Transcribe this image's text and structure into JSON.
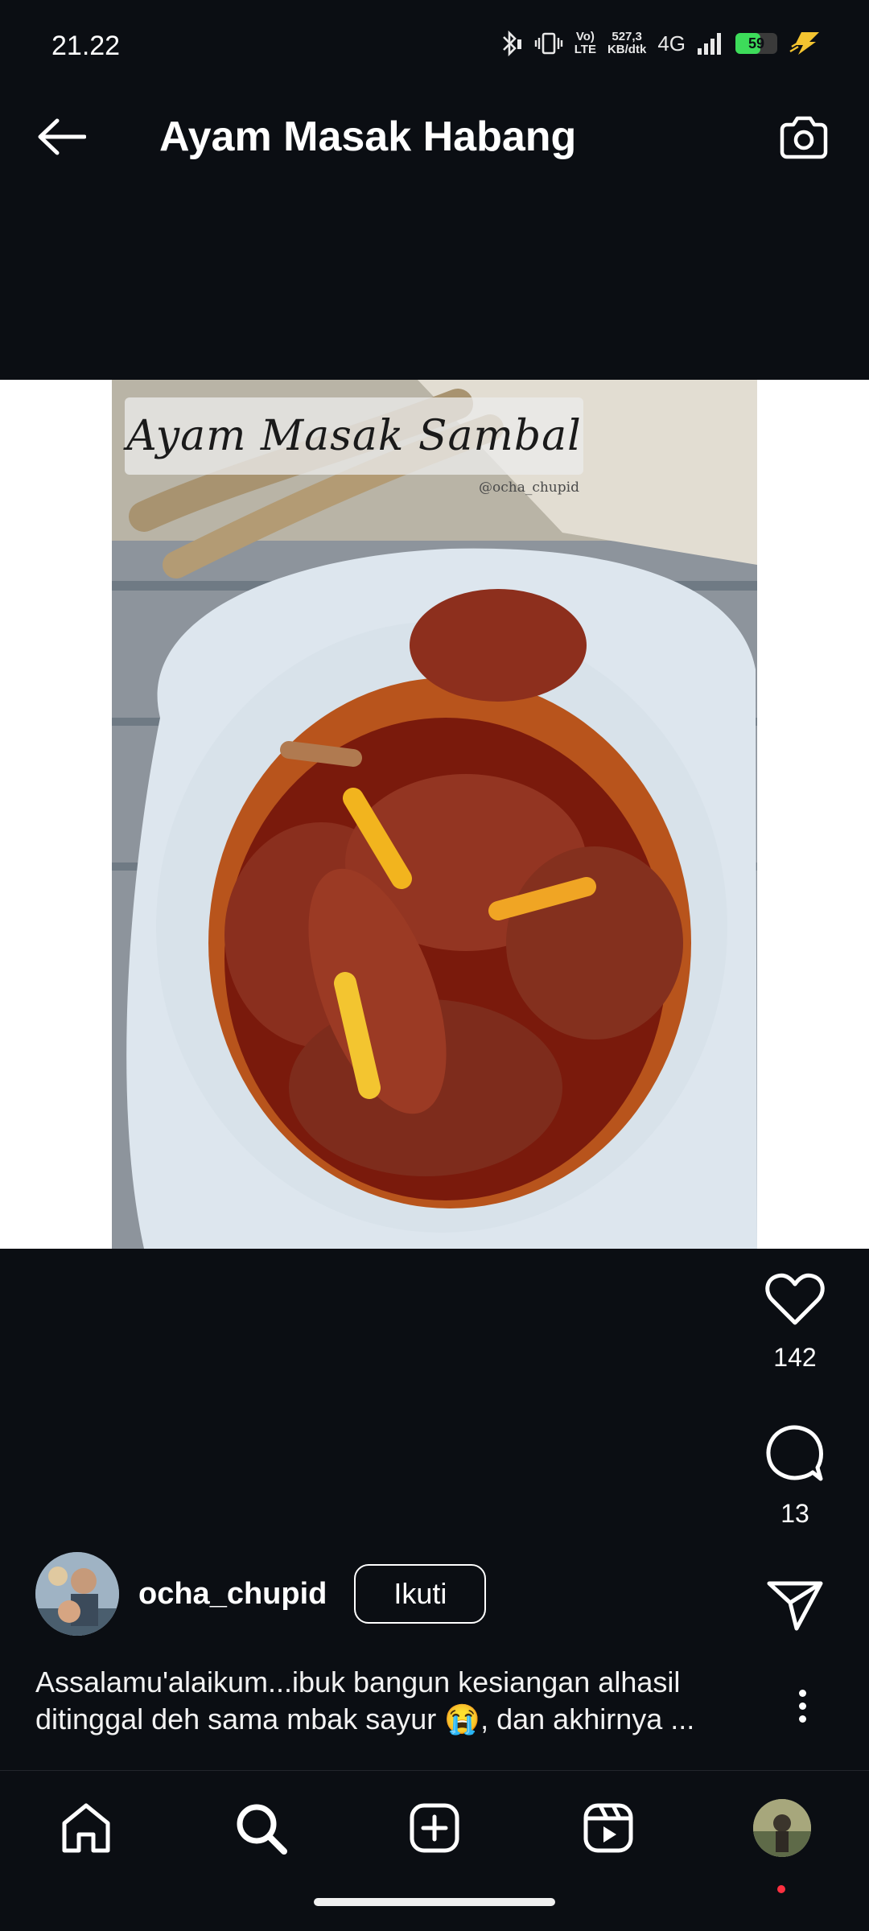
{
  "status_bar": {
    "time": "21.22",
    "volte_top": "Vo)",
    "volte_bottom": "LTE",
    "speed_top": "527,3",
    "speed_bottom": "KB/dtk",
    "network": "4G",
    "battery_level": "59",
    "battery_fraction": 0.59,
    "icons": [
      "bluetooth-icon",
      "vibrate-icon",
      "signal-icon",
      "charging-icon"
    ]
  },
  "header": {
    "title": "Ayam Masak Habang",
    "back_icon": "arrow-left-icon",
    "camera_icon": "camera-icon"
  },
  "post": {
    "image_title": "Ayam Masak Sambal",
    "image_credit": "@ocha_chupid",
    "likes": "142",
    "comments": "13",
    "username": "ocha_chupid",
    "follow_label": "Ikuti",
    "caption_line1": "Assalamu'alaikum...ibuk bangun kesiangan alhasil",
    "caption_line2": "ditinggal deh sama mbak sayur 😭, dan akhirnya ..."
  },
  "bottom_nav": {
    "items": [
      "home-icon",
      "search-icon",
      "create-icon",
      "reels-icon",
      "profile-avatar"
    ]
  },
  "colors": {
    "background": "#0b0e13",
    "text": "#ffffff",
    "battery": "#3ddc5a",
    "notification_dot": "#ff3040"
  }
}
